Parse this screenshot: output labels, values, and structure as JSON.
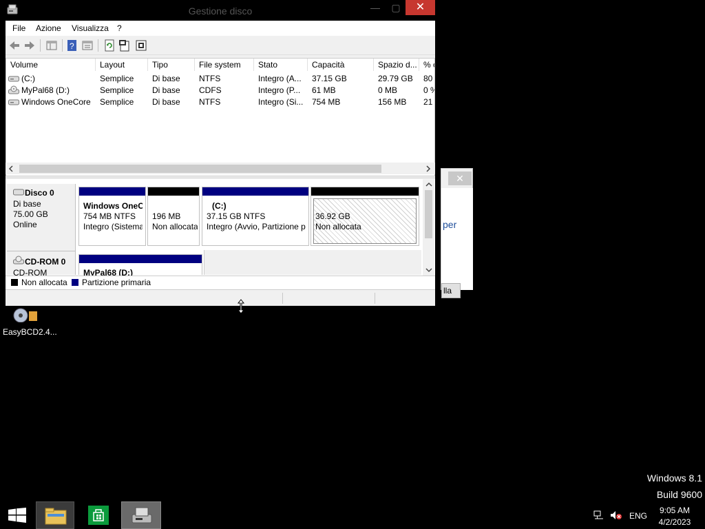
{
  "window": {
    "title": "Gestione disco",
    "close_glyph": "✕",
    "min_glyph": "—",
    "max_glyph": "▢"
  },
  "menu": [
    "File",
    "Azione",
    "Visualizza",
    "?"
  ],
  "toolbar": {
    "icons": [
      "back-icon",
      "forward-icon",
      "console-tree-icon",
      "help-icon",
      "properties-icon",
      "refresh-icon",
      "rescan-icon",
      "settings-icon"
    ]
  },
  "list": {
    "columns": [
      "Volume",
      "Layout",
      "Tipo",
      "File system",
      "Stato",
      "Capacità",
      "Spazio d...",
      "% c"
    ],
    "rows": [
      [
        "(C:)",
        "Semplice",
        "Di base",
        "NTFS",
        "Integro (A...",
        "37.15 GB",
        "29.79 GB",
        "80"
      ],
      [
        "MyPal68 (D:)",
        "Semplice",
        "Di base",
        "CDFS",
        "Integro (P...",
        "61 MB",
        "0 MB",
        "0 %"
      ],
      [
        "Windows OneCore",
        "Semplice",
        "Di base",
        "NTFS",
        "Integro (Si...",
        "754 MB",
        "156 MB",
        "21"
      ]
    ]
  },
  "disk0": {
    "name": "Disco 0",
    "type": "Di base",
    "size": "75.00 GB",
    "status": "Online",
    "partitions": [
      {
        "title": "Windows OneC",
        "line1": "754 MB NTFS",
        "line2": "Integro (Sistema"
      },
      {
        "title": "",
        "line1": "196 MB",
        "line2": "Non allocata"
      },
      {
        "title": "(C:)",
        "line1": "37.15 GB NTFS",
        "line2": "Integro (Avvio, Partizione p"
      },
      {
        "title": "",
        "line1": "36.92 GB",
        "line2": "Non allocata"
      }
    ]
  },
  "cdrom0": {
    "name": "CD-ROM 0",
    "type": "CD-ROM",
    "partition_title": "MyPal68  (D:)"
  },
  "legend": {
    "unallocated": "Non allocata",
    "primary": "Partizione primaria"
  },
  "colors": {
    "primary": "#000080",
    "unallocated": "#000000",
    "close_red": "#c7372f"
  },
  "background_dialog": {
    "close_glyph": "✕",
    "peek_text": "per",
    "button_text": "lla"
  },
  "desktop": {
    "icon_label": "EasyBCD2.4...",
    "watermark_line1": "Windows 8.1",
    "watermark_line2": "Build 9600"
  },
  "taskbar": {
    "lang": "ENG",
    "time": "9:05 AM",
    "date": "4/2/2023"
  }
}
